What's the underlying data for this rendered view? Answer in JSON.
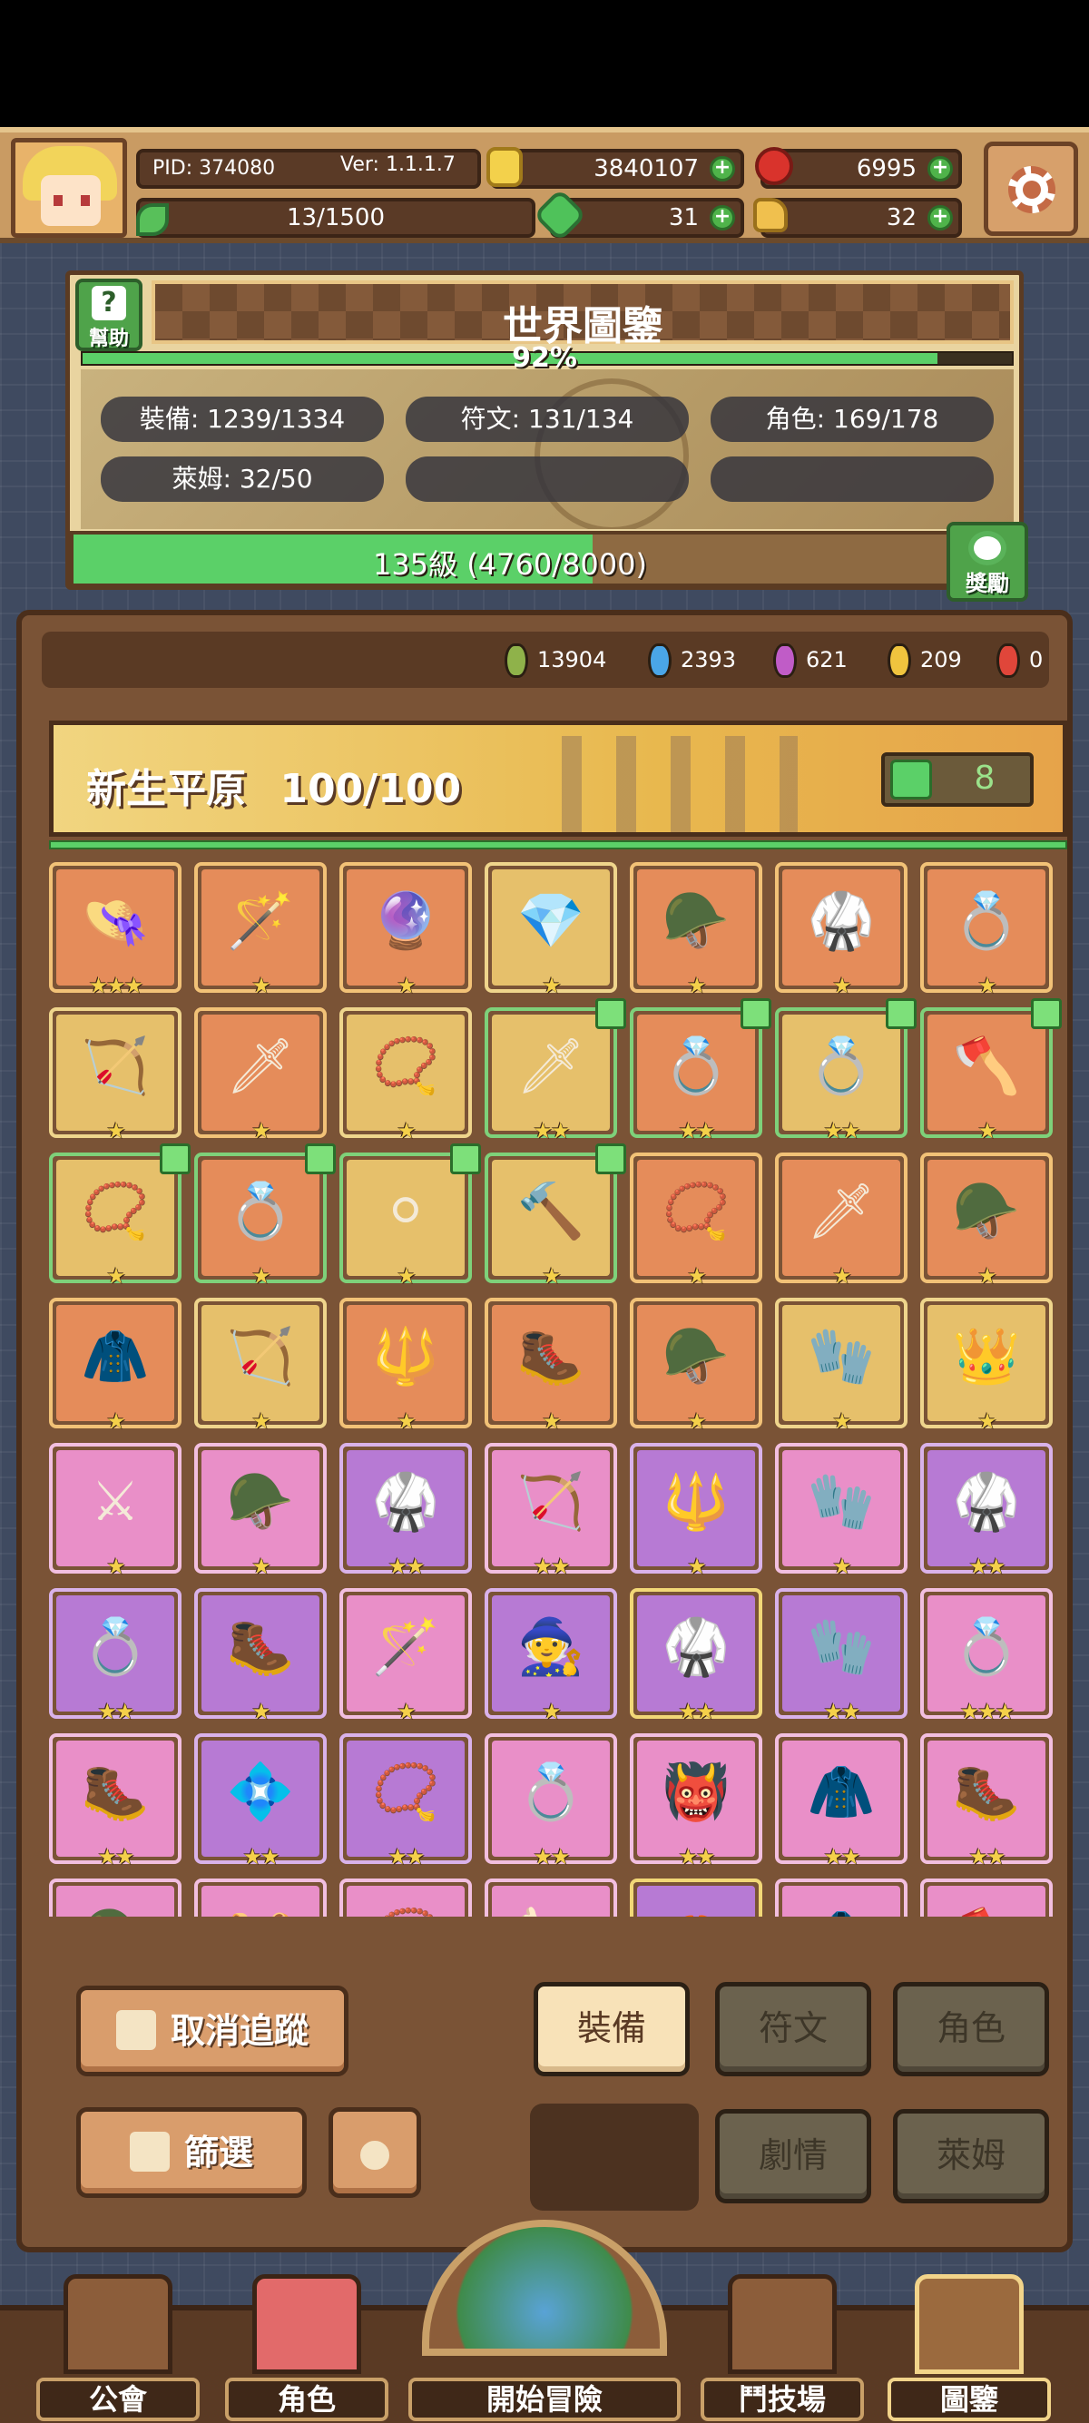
{
  "header": {
    "pid": "PID: 374080",
    "version": "Ver: 1.1.1.7",
    "gold": "3840107",
    "gems": "6995",
    "exp": "13/1500",
    "clovers": "31",
    "hands": "32"
  },
  "codex": {
    "title": "世界圖鑒",
    "help_label": "幫助",
    "percent": "92%",
    "percent_value": 0.92,
    "stats": [
      "裝備: 1239/1334",
      "符文: 131/134",
      "角色: 169/178",
      "萊姆: 32/50"
    ],
    "level_text": "135級 (4760/8000)",
    "level_progress": 0.595,
    "reward_label": "獎勵"
  },
  "resources": [
    {
      "value": "13904",
      "color": "#8fb24a"
    },
    {
      "value": "2393",
      "color": "#4aa6e8"
    },
    {
      "value": "621",
      "color": "#c05cc7"
    },
    {
      "value": "209",
      "color": "#f0c43e"
    },
    {
      "value": "0",
      "color": "#e0463a"
    }
  ],
  "zone": {
    "name": "新生平原",
    "progress": "100/100",
    "likes": "8"
  },
  "items": [
    {
      "style": "c-orange",
      "glyph": "👒",
      "stars": "★★★",
      "icon": "straw-hat-icon"
    },
    {
      "style": "c-orange",
      "glyph": "🪄",
      "stars": "★",
      "icon": "ice-staff-icon"
    },
    {
      "style": "c-orange",
      "glyph": "🔮",
      "stars": "★",
      "icon": "crystal-orb-icon"
    },
    {
      "style": "c-gold",
      "glyph": "💎",
      "stars": "★",
      "icon": "diamond-icon"
    },
    {
      "style": "c-orange",
      "glyph": "🪖",
      "stars": "★",
      "icon": "green-helmet-icon"
    },
    {
      "style": "c-orange",
      "glyph": "🥋",
      "stars": "★",
      "icon": "green-armor-icon"
    },
    {
      "style": "c-orange",
      "glyph": "💍",
      "stars": "★",
      "icon": "green-ring-icon"
    },
    {
      "style": "c-gold",
      "glyph": "🏹",
      "stars": "★",
      "icon": "crossbow-icon"
    },
    {
      "style": "c-orange",
      "glyph": "🗡",
      "stars": "★",
      "icon": "spear-icon"
    },
    {
      "style": "c-gold",
      "glyph": "📿",
      "stars": "★",
      "icon": "heart-necklace-icon"
    },
    {
      "style": "c-gold-g",
      "glyph": "🗡",
      "stars": "★★",
      "icon": "gold-sword-icon",
      "liked": true
    },
    {
      "style": "c-orange-g",
      "glyph": "💍",
      "stars": "★★",
      "icon": "gold-ring-icon",
      "liked": true
    },
    {
      "style": "c-gold-g",
      "glyph": "💍",
      "stars": "★★",
      "icon": "gem-ring-icon",
      "liked": true
    },
    {
      "style": "c-orange-g",
      "glyph": "🪓",
      "stars": "★",
      "icon": "axe-icon",
      "liked": true
    },
    {
      "style": "c-gold-g",
      "glyph": "📿",
      "stars": "★",
      "icon": "pearl-necklace-icon",
      "liked": true
    },
    {
      "style": "c-orange-g",
      "glyph": "💍",
      "stars": "★",
      "icon": "silver-ring-icon",
      "liked": true
    },
    {
      "style": "c-gold-g",
      "glyph": "⚪",
      "stars": "★",
      "icon": "pearl-orb-icon",
      "liked": true
    },
    {
      "style": "c-gold-g",
      "glyph": "🔨",
      "stars": "★",
      "icon": "hammer-icon",
      "liked": true
    },
    {
      "style": "c-orange",
      "glyph": "📿",
      "stars": "★",
      "icon": "leather-necklace-icon"
    },
    {
      "style": "c-orange",
      "glyph": "🗡",
      "stars": "★",
      "icon": "dark-spear-icon"
    },
    {
      "style": "c-orange",
      "glyph": "🪖",
      "stars": "★",
      "icon": "red-helmet-icon"
    },
    {
      "style": "c-orange",
      "glyph": "🧥",
      "stars": "★",
      "icon": "red-cloak-icon"
    },
    {
      "style": "c-gold",
      "glyph": "🏹",
      "stars": "★",
      "icon": "ice-bow-icon"
    },
    {
      "style": "c-orange",
      "glyph": "🔱",
      "stars": "★",
      "icon": "ice-spear-icon"
    },
    {
      "style": "c-orange",
      "glyph": "🥾",
      "stars": "★",
      "icon": "ice-boots-icon"
    },
    {
      "style": "c-orange",
      "glyph": "🪖",
      "stars": "★",
      "icon": "leaf-helmet-icon"
    },
    {
      "style": "c-gold",
      "glyph": "🧤",
      "stars": "★",
      "icon": "green-glove-icon"
    },
    {
      "style": "c-gold",
      "glyph": "👑",
      "stars": "★",
      "icon": "crown-icon"
    },
    {
      "style": "c-pink",
      "glyph": "⚔",
      "stars": "★",
      "icon": "steel-sword-icon"
    },
    {
      "style": "c-pink",
      "glyph": "🪖",
      "stars": "★",
      "icon": "green-hood-icon"
    },
    {
      "style": "c-violet",
      "glyph": "🥋",
      "stars": "★★",
      "icon": "green-vest-icon"
    },
    {
      "style": "c-pink",
      "glyph": "🏹",
      "stars": "★★",
      "icon": "wood-bow-icon"
    },
    {
      "style": "c-violet",
      "glyph": "🔱",
      "stars": "★",
      "icon": "silver-spear-icon"
    },
    {
      "style": "c-pink",
      "glyph": "🧤",
      "stars": "★",
      "icon": "leather-glove-icon"
    },
    {
      "style": "c-violet",
      "glyph": "🥋",
      "stars": "★★",
      "icon": "white-armor-icon"
    },
    {
      "style": "c-violet",
      "glyph": "💍",
      "stars": "★★",
      "icon": "silver-band-icon"
    },
    {
      "style": "c-violet",
      "glyph": "🥾",
      "stars": "★",
      "icon": "steel-boots-icon"
    },
    {
      "style": "c-pink",
      "glyph": "🪄",
      "stars": "★",
      "icon": "aqua-wand-icon"
    },
    {
      "style": "c-violet",
      "glyph": "🧙",
      "stars": "★",
      "icon": "aqua-hat-icon"
    },
    {
      "style": "c-violet-y",
      "glyph": "🥋",
      "stars": "★★",
      "icon": "aqua-armor-icon"
    },
    {
      "style": "c-violet",
      "glyph": "🧤",
      "stars": "★★",
      "icon": "aqua-gauntlet-icon"
    },
    {
      "style": "c-pink",
      "glyph": "💍",
      "stars": "★★★",
      "icon": "aqua-ring-icon"
    },
    {
      "style": "c-pink",
      "glyph": "🥾",
      "stars": "★★",
      "icon": "teal-boots-icon"
    },
    {
      "style": "c-violet",
      "glyph": "💠",
      "stars": "★★",
      "icon": "teal-gem-icon"
    },
    {
      "style": "c-violet",
      "glyph": "📿",
      "stars": "★★",
      "icon": "teal-necklace-icon"
    },
    {
      "style": "c-pink",
      "glyph": "💍",
      "stars": "★★",
      "icon": "teal-ring-icon"
    },
    {
      "style": "c-pink",
      "glyph": "👹",
      "stars": "★★",
      "icon": "red-mask-icon"
    },
    {
      "style": "c-pink",
      "glyph": "🧥",
      "stars": "★★",
      "icon": "red-coat-icon"
    },
    {
      "style": "c-pink",
      "glyph": "🥾",
      "stars": "★★",
      "icon": "red-boots-icon"
    },
    {
      "style": "c-pink",
      "glyph": "🪖",
      "stars": "",
      "icon": "partial-item-icon"
    },
    {
      "style": "c-pink",
      "glyph": "🧺",
      "stars": "",
      "icon": "partial-item-icon"
    },
    {
      "style": "c-pink",
      "glyph": "📿",
      "stars": "",
      "icon": "partial-item-icon"
    },
    {
      "style": "c-pink",
      "glyph": "🍗",
      "stars": "",
      "icon": "partial-item-icon"
    },
    {
      "style": "c-violet-y",
      "glyph": "🦀",
      "stars": "",
      "icon": "partial-item-icon"
    },
    {
      "style": "c-pink",
      "glyph": "🧥",
      "stars": "",
      "icon": "partial-item-icon"
    },
    {
      "style": "c-pink",
      "glyph": "🪓",
      "stars": "",
      "icon": "partial-item-icon"
    }
  ],
  "controls": {
    "untrack": "取消追蹤",
    "filter": "篩選",
    "tabs": [
      "裝備",
      "符文",
      "角色",
      "劇情",
      "萊姆"
    ]
  },
  "nav": [
    "公會",
    "角色",
    "開始冒險",
    "鬥技場",
    "圖鑒"
  ]
}
